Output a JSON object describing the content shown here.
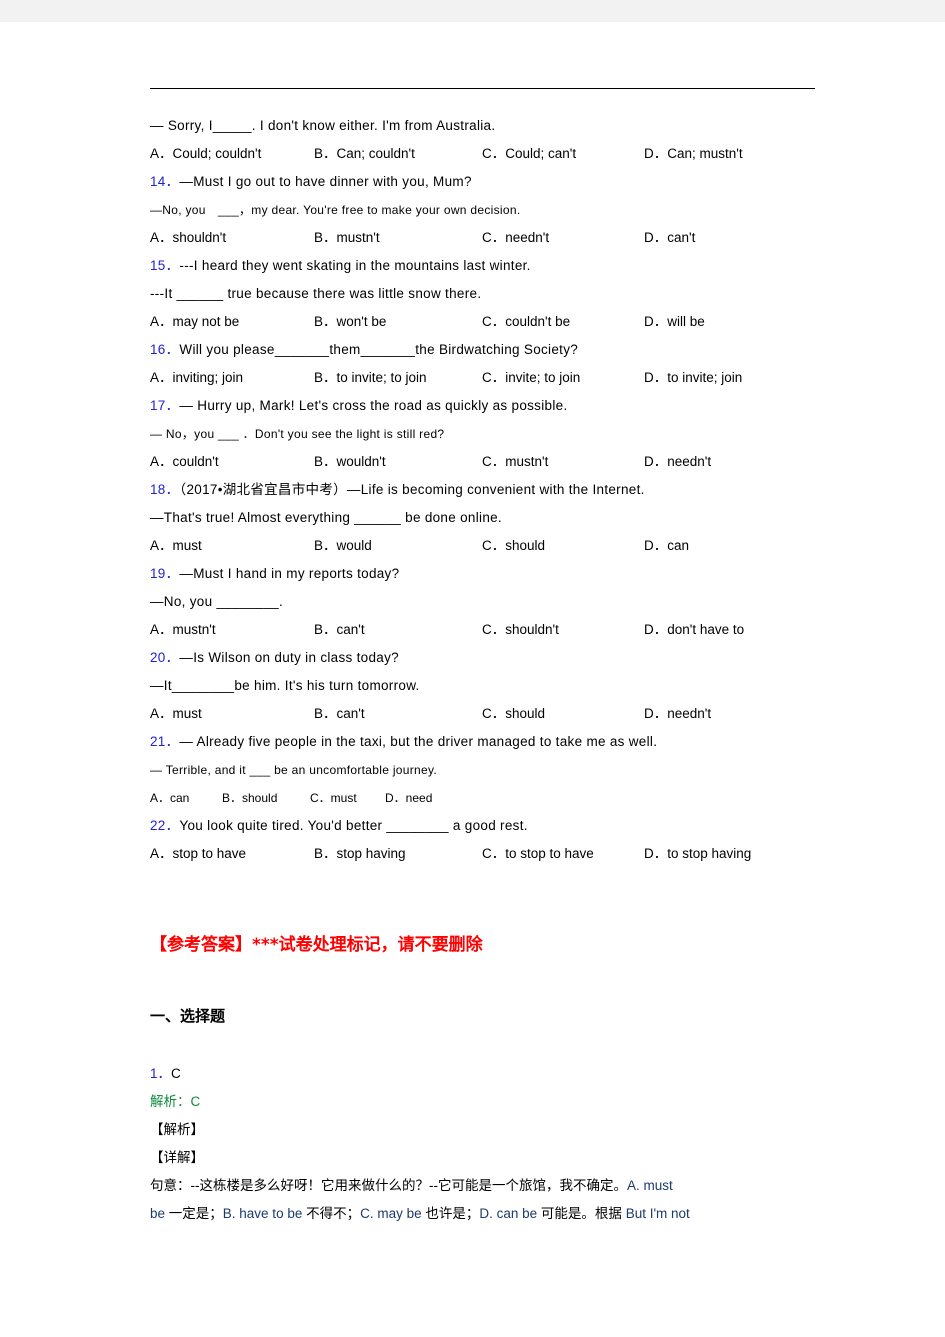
{
  "document": {
    "type": "exam-worksheet",
    "language": "zh-CN/en",
    "colors": {
      "question_number": "#2222cc",
      "answer_header": "#ff0000",
      "analysis_green": "#0a8a3c",
      "english_in_explanation": "#1b3a6b",
      "page_background": "#ffffff",
      "canvas_background": "#f2f2f2"
    }
  },
  "questions": [
    {
      "id": "13-cont",
      "number": "",
      "stem_lines": [
        "— Sorry, I_____. I don't know either. I'm from Australia."
      ],
      "options": [
        "A．Could; couldn't",
        "B．Can; couldn't",
        "C．Could; can't",
        "D．Can; mustn't"
      ]
    },
    {
      "id": "14",
      "number": "14．",
      "stem_lines": [
        "—Must I go out to have dinner with you, Mum?",
        "—No, you　___，my dear. You're free to make  your own decision."
      ],
      "options": [
        "A．shouldn't",
        "B．mustn't",
        "C．needn't",
        "D．can't"
      ]
    },
    {
      "id": "15",
      "number": "15．",
      "stem_lines": [
        "---I heard they went skating in the mountains last winter.",
        "---It ______ true because there was little snow there."
      ],
      "options": [
        "A．may not be",
        "B．won't be",
        "C．couldn't be",
        "D．will be"
      ]
    },
    {
      "id": "16",
      "number": "16．",
      "stem_lines": [
        "Will you please_______them_______the Birdwatching Society?"
      ],
      "options": [
        "A．inviting; join",
        "B．to invite; to join",
        "C．invite; to join",
        "D．to invite; join"
      ]
    },
    {
      "id": "17",
      "number": "17．",
      "stem_lines": [
        "— Hurry up, Mark! Let's cross the road as quickly as possible.",
        "— No，you ___ ．Don't you see the light is still red?"
      ],
      "options": [
        "A．couldn't",
        "B．wouldn't",
        "C．mustn't",
        "D．needn't"
      ]
    },
    {
      "id": "18",
      "number": "18．",
      "stem_lines": [
        "（2017•湖北省宜昌市中考）—Life is becoming convenient with the Internet.",
        "—That's true! Almost everything ______   be done online."
      ],
      "options": [
        "A．must",
        "B．would",
        "C．should",
        "D．can"
      ]
    },
    {
      "id": "19",
      "number": "19．",
      "stem_lines": [
        "—Must I hand in my reports today?",
        "—No, you ________."
      ],
      "options": [
        "A．mustn't",
        "B．can't",
        "C．shouldn't",
        "D．don't have to"
      ]
    },
    {
      "id": "20",
      "number": "20．",
      "stem_lines": [
        "—Is Wilson on duty in class today?",
        "—It________be him. It's his turn tomorrow."
      ],
      "options": [
        "A．must",
        "B．can't",
        "C．should",
        "D．needn't"
      ]
    },
    {
      "id": "21",
      "number": "21．",
      "stem_lines": [
        "— Already five people in the taxi, but the driver managed to take me as well.",
        "— Terrible, and it ___ be an uncomfortable journey."
      ],
      "options": [
        "A．can",
        "B．should",
        "C．must",
        "D．need"
      ],
      "compact_options": true
    },
    {
      "id": "22",
      "number": "22．",
      "stem_lines": [
        "You look quite tired. You'd better ________ a good rest."
      ],
      "options": [
        "A．stop to have",
        "B．stop having",
        "C．to stop to have",
        "D．to stop having"
      ]
    }
  ],
  "answer_section": {
    "header": "【参考答案】***试卷处理标记，请不要删除",
    "section_title": "一、选择题",
    "entries": [
      {
        "number": "1．",
        "answer": "C"
      }
    ],
    "analysis_label": "解析：C",
    "tag_analysis": "【解析】",
    "tag_detail": "【详解】",
    "explanation_lines": [
      {
        "segments": [
          {
            "text": "句意：--这栋楼是多么好呀！它用来做什么的？--它可能是一个旅馆，我不确定。",
            "style": "zh"
          },
          {
            "text": "A. must",
            "style": "en"
          }
        ]
      },
      {
        "segments": [
          {
            "text": "be ",
            "style": "en"
          },
          {
            "text": "一定是；",
            "style": "zh"
          },
          {
            "text": "B. have to be ",
            "style": "en"
          },
          {
            "text": "不得不；",
            "style": "zh"
          },
          {
            "text": "C. may be ",
            "style": "en"
          },
          {
            "text": "也许是；",
            "style": "zh"
          },
          {
            "text": "D. can be ",
            "style": "en"
          },
          {
            "text": "可能是。根据 ",
            "style": "zh"
          },
          {
            "text": "But I'm not",
            "style": "en"
          }
        ]
      }
    ]
  }
}
